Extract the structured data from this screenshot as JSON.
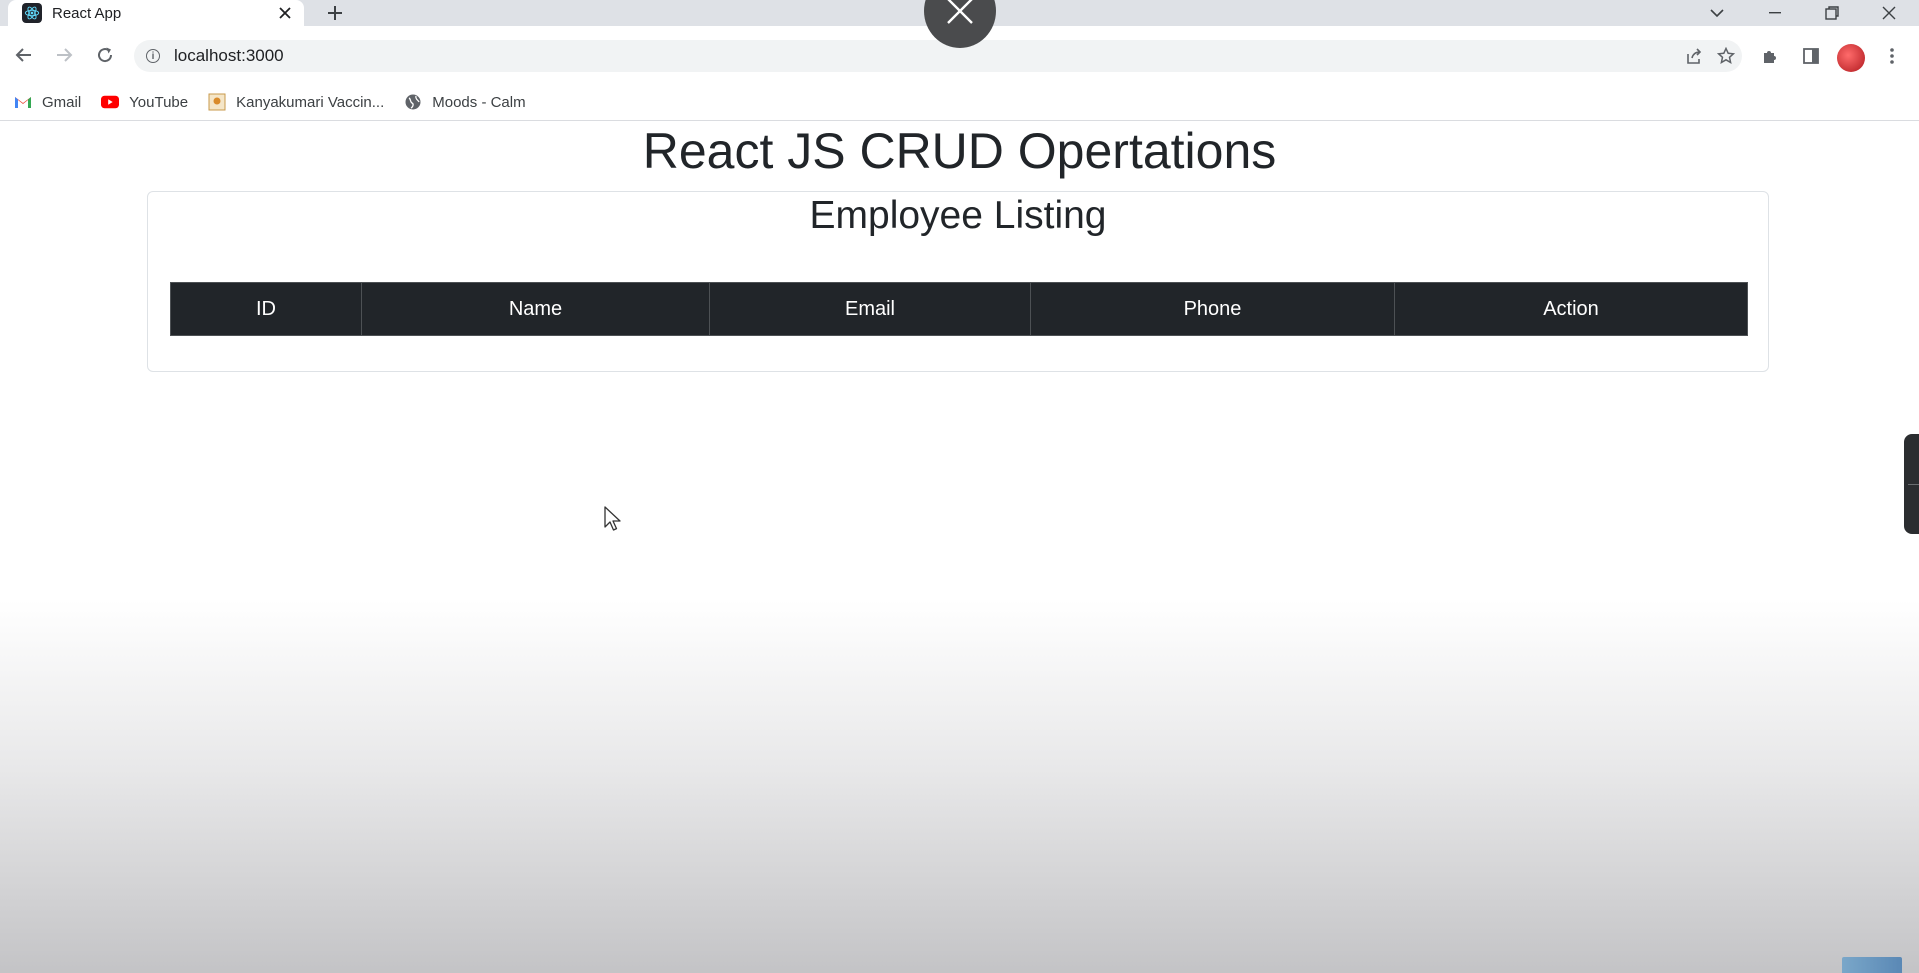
{
  "browser": {
    "tab_title": "React App",
    "url": "localhost:3000",
    "bookmarks": [
      {
        "label": "Gmail",
        "icon": "gmail-icon"
      },
      {
        "label": "YouTube",
        "icon": "youtube-icon"
      },
      {
        "label": "Kanyakumari Vaccin...",
        "icon": "bookmark-image-icon"
      },
      {
        "label": "Moods - Calm",
        "icon": "globe-icon"
      }
    ]
  },
  "page": {
    "title": "React JS CRUD Opertations",
    "card_title": "Employee Listing",
    "table": {
      "columns": [
        "ID",
        "Name",
        "Email",
        "Phone",
        "Action"
      ],
      "rows": []
    }
  },
  "colors": {
    "table_header_bg": "#212529",
    "text": "#212529"
  }
}
